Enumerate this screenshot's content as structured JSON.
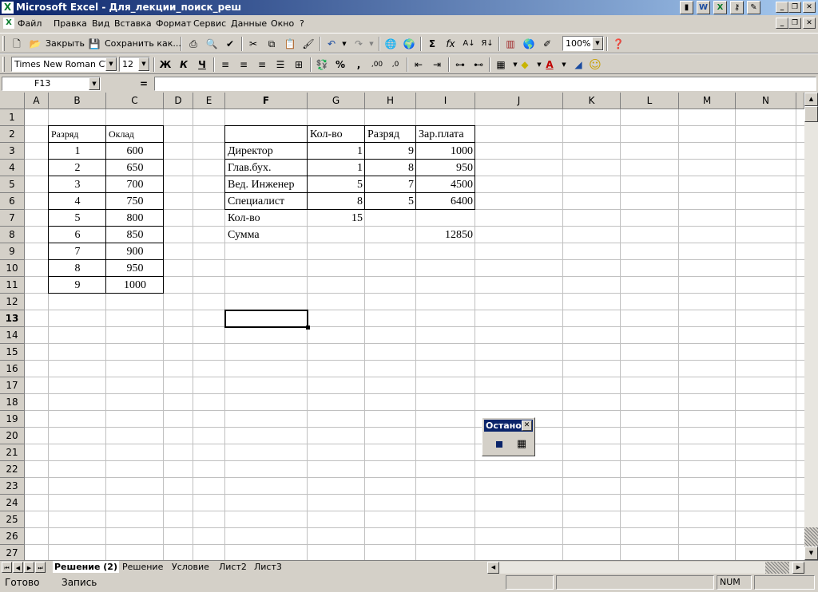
{
  "window": {
    "title": "Microsoft Excel - Для_лекции_поиск_реш",
    "minimize": "_",
    "restore": "❐",
    "close": "✕"
  },
  "menu": [
    "Файл",
    "Правка",
    "Вид",
    "Вставка",
    "Формат",
    "Сервис",
    "Данные",
    "Окно",
    "?"
  ],
  "toolbar": {
    "close_label": "Закрыть",
    "save_as_label": "Сохранить как...",
    "zoom": "100%"
  },
  "format_toolbar": {
    "font": "Times New Roman CYR",
    "size": "12",
    "bold": "Ж",
    "italic": "К",
    "underline": "Ч",
    "percent": "%",
    "comma": ","
  },
  "formula_bar": {
    "name_box": "F13",
    "equals": "=",
    "formula": ""
  },
  "columns": [
    "A",
    "B",
    "C",
    "D",
    "E",
    "F",
    "G",
    "H",
    "I",
    "J",
    "K",
    "L",
    "M",
    "N"
  ],
  "rows": [
    "1",
    "2",
    "3",
    "4",
    "5",
    "6",
    "7",
    "8",
    "9",
    "10",
    "11",
    "12",
    "13",
    "14",
    "15",
    "16",
    "17",
    "18",
    "19",
    "20",
    "21",
    "22",
    "23",
    "24",
    "25",
    "26",
    "27"
  ],
  "table_left": {
    "headers": [
      "Разряд",
      "Оклад"
    ],
    "rows": [
      [
        "1",
        "600"
      ],
      [
        "2",
        "650"
      ],
      [
        "3",
        "700"
      ],
      [
        "4",
        "750"
      ],
      [
        "5",
        "800"
      ],
      [
        "6",
        "850"
      ],
      [
        "7",
        "900"
      ],
      [
        "8",
        "950"
      ],
      [
        "9",
        "1000"
      ]
    ]
  },
  "table_right": {
    "headers": [
      "",
      "Кол-во",
      "Разряд",
      "Зар.плата"
    ],
    "rows": [
      [
        "Директор",
        "1",
        "9",
        "1000"
      ],
      [
        "Глав.бух.",
        "1",
        "8",
        "950"
      ],
      [
        "Вед. Инженер",
        "5",
        "7",
        "4500"
      ],
      [
        "Специалист",
        "8",
        "5",
        "6400"
      ]
    ],
    "count_label": "Кол-во",
    "count_value": "15",
    "sum_label": "Сумма",
    "sum_value": "12850"
  },
  "float_toolbar": {
    "title": "Останов"
  },
  "sheet_tabs": [
    "Решение (2)",
    "Решение",
    "Условие",
    "Лист2",
    "Лист3"
  ],
  "active_tab": "Решение (2)",
  "status": {
    "ready": "Готово",
    "record": "Запись",
    "num": "NUM"
  }
}
